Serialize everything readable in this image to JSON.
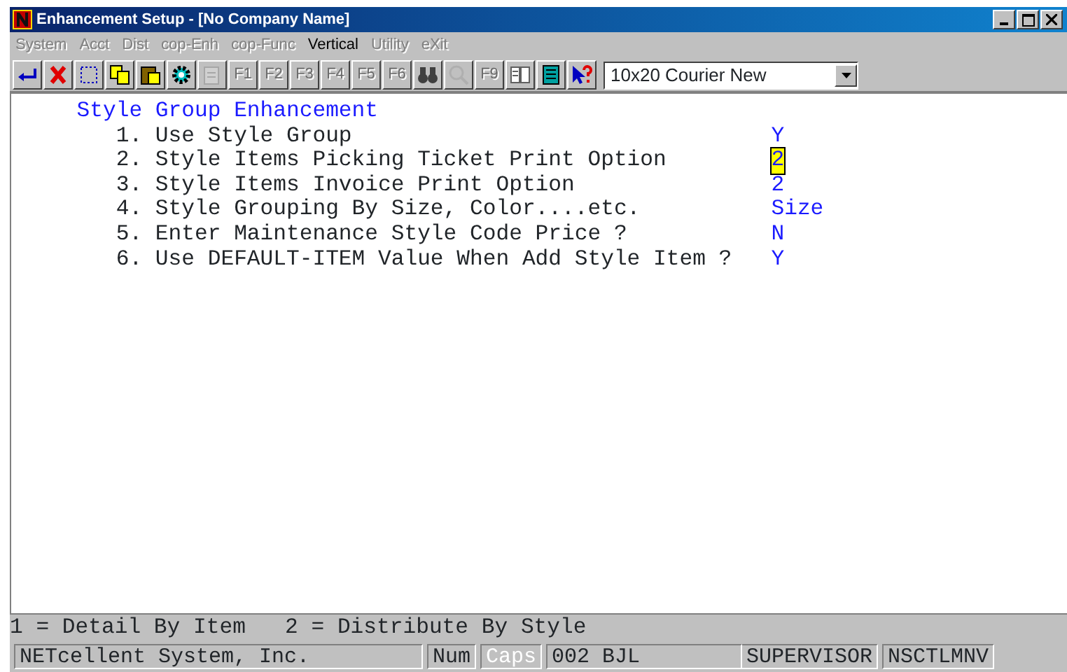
{
  "window": {
    "title": "Enhancement Setup - [No Company Name]"
  },
  "menu": [
    {
      "label": "System",
      "disabled": true
    },
    {
      "label": "Acct",
      "disabled": true
    },
    {
      "label": "Dist",
      "disabled": true
    },
    {
      "label": "cop-Enh",
      "disabled": true
    },
    {
      "label": "cop-Func",
      "disabled": true
    },
    {
      "label": "Vertical",
      "disabled": false
    },
    {
      "label": "Utility",
      "disabled": true
    },
    {
      "label": "eXit",
      "disabled": true
    }
  ],
  "toolbar": [
    {
      "kind": "enter",
      "disabled": false
    },
    {
      "kind": "cancel",
      "disabled": false
    },
    {
      "kind": "select",
      "disabled": false
    },
    {
      "kind": "copy",
      "disabled": false
    },
    {
      "kind": "paste",
      "disabled": false
    },
    {
      "kind": "gear",
      "disabled": false
    },
    {
      "kind": "document",
      "disabled": true
    },
    {
      "kind": "key",
      "label": "F1",
      "disabled": true
    },
    {
      "kind": "key",
      "label": "F2",
      "disabled": true
    },
    {
      "kind": "key",
      "label": "F3",
      "disabled": true
    },
    {
      "kind": "key",
      "label": "F4",
      "disabled": true
    },
    {
      "kind": "key",
      "label": "F5",
      "disabled": true
    },
    {
      "kind": "key",
      "label": "F6",
      "disabled": true
    },
    {
      "kind": "binoculars",
      "disabled": false
    },
    {
      "kind": "magnifier",
      "disabled": true
    },
    {
      "kind": "key",
      "label": "F9",
      "disabled": true
    },
    {
      "kind": "book",
      "disabled": false
    },
    {
      "kind": "screen",
      "disabled": false
    },
    {
      "kind": "help",
      "disabled": false
    }
  ],
  "font_select": {
    "value": "10x20 Courier New"
  },
  "form": {
    "heading": "Style Group Enhancement",
    "items": [
      {
        "number": "1.",
        "label": "Use Style Group",
        "value": "Y",
        "selected": false
      },
      {
        "number": "2.",
        "label": "Style Items Picking Ticket Print Option",
        "value": "2",
        "selected": true
      },
      {
        "number": "3.",
        "label": "Style Items Invoice Print Option",
        "value": "2",
        "selected": false
      },
      {
        "number": "4.",
        "label": "Style Grouping By Size, Color....etc.",
        "value": "Size",
        "selected": false
      },
      {
        "number": "5.",
        "label": "Enter Maintenance Style Code Price ?",
        "value": "N",
        "selected": false
      },
      {
        "number": "6.",
        "label": "Use DEFAULT-ITEM Value When Add Style Item ?",
        "value": "Y",
        "selected": false
      }
    ]
  },
  "hint": "1 = Detail By Item   2 = Distribute By Style",
  "status_bar": [
    {
      "text": "NETcellent System, Inc.",
      "kind": "company",
      "disabled": false
    },
    {
      "text": "Num",
      "kind": "key",
      "disabled": false
    },
    {
      "text": "Caps",
      "kind": "key",
      "disabled": true
    },
    {
      "text": "002 BJL",
      "kind": "user",
      "disabled": false
    },
    {
      "text": "SUPERVISOR",
      "kind": "role",
      "disabled": false
    },
    {
      "text": "NSCTLMNV",
      "kind": "program",
      "disabled": false
    }
  ]
}
